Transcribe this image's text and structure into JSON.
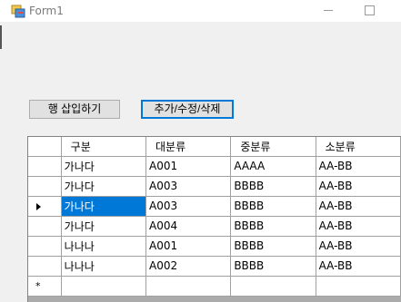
{
  "window": {
    "title": "Form1",
    "icon": "winforms-app-icon"
  },
  "buttons": {
    "insert_row": "행 삽입하기",
    "crud": "추가/수정/삭제"
  },
  "grid": {
    "columns": [
      "구분",
      "대분류",
      "중분류",
      "소분류"
    ],
    "rows": [
      [
        "가나다",
        "A001",
        "AAAA",
        "AA-BB"
      ],
      [
        "가나다",
        "A003",
        "BBBB",
        "AA-BB"
      ],
      [
        "가나다",
        "A003",
        "BBBB",
        "AA-BB"
      ],
      [
        "가나다",
        "A004",
        "BBBB",
        "AA-BB"
      ],
      [
        "나나나",
        "A001",
        "BBBB",
        "AA-BB"
      ],
      [
        "나나나",
        "A002",
        "BBBB",
        "AA-BB"
      ]
    ],
    "current_row_marker": "arrow",
    "new_row_marker": "*",
    "selection_color": "#0078d7"
  }
}
